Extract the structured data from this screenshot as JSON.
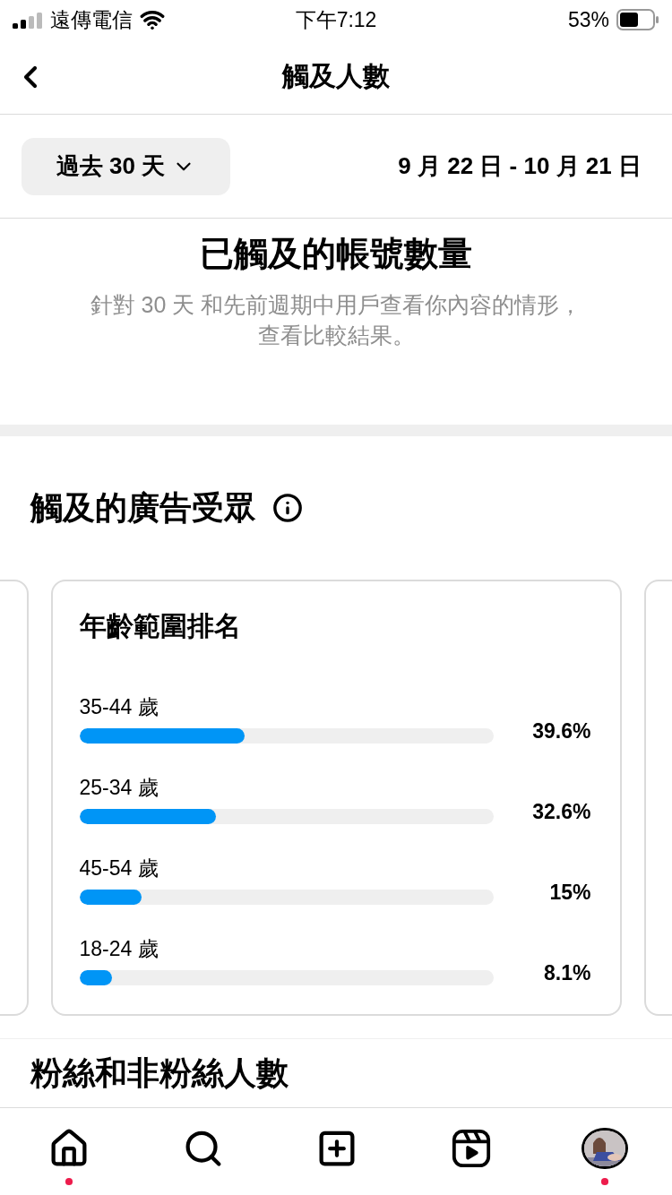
{
  "status_bar": {
    "carrier": "遠傳電信",
    "time": "下午7:12",
    "battery": "53%"
  },
  "header": {
    "title": "觸及人數"
  },
  "date_range": {
    "selector": "過去 30 天",
    "dates": "9 月 22 日 - 10 月 21 日"
  },
  "reached": {
    "title": "已觸及的帳號數量",
    "description": "針對 30 天 和先前週期中用戶查看你內容的情形，查看比較結果。"
  },
  "audience": {
    "title": "觸及的廣告受眾",
    "card": {
      "title": "年齡範圍排名",
      "rows": [
        {
          "label": "35-44 歲",
          "level": 0.4,
          "value": "39.6%"
        },
        {
          "label": "25-34 歲",
          "level": 0.33,
          "value": "32.6%"
        },
        {
          "label": "45-54 歲",
          "level": 0.15,
          "value": "15%"
        },
        {
          "label": "18-24 歲",
          "level": 0.08,
          "value": "8.1%"
        }
      ]
    }
  },
  "next_section": {
    "title": "粉絲和非粉絲人數"
  },
  "tab_bar": [
    {
      "kind": "home",
      "badge": true
    },
    {
      "kind": "search",
      "badge": false
    },
    {
      "kind": "create",
      "badge": false
    },
    {
      "kind": "reels",
      "badge": false
    },
    {
      "kind": "profile",
      "badge": true
    }
  ]
}
